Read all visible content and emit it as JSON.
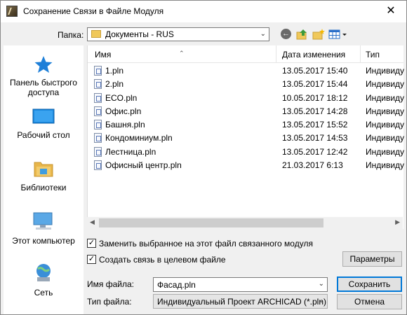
{
  "window": {
    "title": "Сохранение Связи в Файле Модуля",
    "close_glyph": "✕"
  },
  "folder": {
    "label": "Папка:",
    "value": "Документы - RUS"
  },
  "places": [
    {
      "label_line1": "Панель быстрого",
      "label_line2": "доступа",
      "icon": "quick-access-star-icon"
    },
    {
      "label_line1": "Рабочий стол",
      "label_line2": "",
      "icon": "desktop-icon"
    },
    {
      "label_line1": "Библиотеки",
      "label_line2": "",
      "icon": "libraries-icon"
    },
    {
      "label_line1": "Этот компьютер",
      "label_line2": "",
      "icon": "computer-icon"
    },
    {
      "label_line1": "Сеть",
      "label_line2": "",
      "icon": "network-icon"
    }
  ],
  "columns": {
    "name": "Имя",
    "date": "Дата изменения",
    "type": "Тип"
  },
  "files": [
    {
      "name": "1.pln",
      "date": "13.05.2017 15:40",
      "type": "Индивиду"
    },
    {
      "name": "2.pln",
      "date": "13.05.2017 15:44",
      "type": "Индивиду"
    },
    {
      "name": "ECO.pln",
      "date": "10.05.2017 18:12",
      "type": "Индивиду"
    },
    {
      "name": "Офис.pln",
      "date": "13.05.2017 14:28",
      "type": "Индивиду"
    },
    {
      "name": "Башня.pln",
      "date": "13.05.2017 15:52",
      "type": "Индивиду"
    },
    {
      "name": "Кондоминиум.pln",
      "date": "13.05.2017 14:53",
      "type": "Индивиду"
    },
    {
      "name": "Лестница.pln",
      "date": "13.05.2017 12:42",
      "type": "Индивиду"
    },
    {
      "name": "Офисный центр.pln",
      "date": "21.03.2017 6:13",
      "type": "Индивиду"
    }
  ],
  "options": {
    "replace_label": "Заменить выбранное на этот файл связанного модуля",
    "replace_checked": true,
    "create_link_label": "Создать связь в целевом файле",
    "create_link_checked": true,
    "check_glyph": "✓"
  },
  "filename": {
    "label": "Имя файла:",
    "value": "Фасад.pln"
  },
  "filetype": {
    "label": "Тип файла:",
    "value": "Индивидуальный Проект ARCHICAD (*.pln)"
  },
  "buttons": {
    "params": "Параметры",
    "save": "Сохранить",
    "cancel": "Отмена"
  }
}
